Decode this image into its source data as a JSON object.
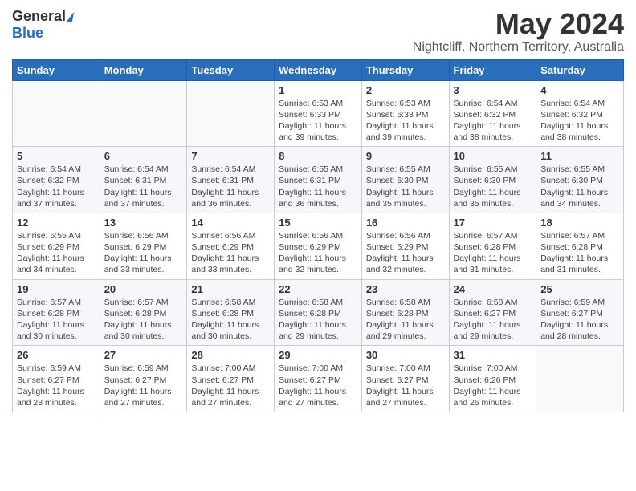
{
  "header": {
    "logo_general": "General",
    "logo_blue": "Blue",
    "month": "May 2024",
    "location": "Nightcliff, Northern Territory, Australia"
  },
  "columns": [
    "Sunday",
    "Monday",
    "Tuesday",
    "Wednesday",
    "Thursday",
    "Friday",
    "Saturday"
  ],
  "weeks": [
    [
      {
        "day": "",
        "sunrise": "",
        "sunset": "",
        "daylight": ""
      },
      {
        "day": "",
        "sunrise": "",
        "sunset": "",
        "daylight": ""
      },
      {
        "day": "",
        "sunrise": "",
        "sunset": "",
        "daylight": ""
      },
      {
        "day": "1",
        "sunrise": "Sunrise: 6:53 AM",
        "sunset": "Sunset: 6:33 PM",
        "daylight": "Daylight: 11 hours and 39 minutes."
      },
      {
        "day": "2",
        "sunrise": "Sunrise: 6:53 AM",
        "sunset": "Sunset: 6:33 PM",
        "daylight": "Daylight: 11 hours and 39 minutes."
      },
      {
        "day": "3",
        "sunrise": "Sunrise: 6:54 AM",
        "sunset": "Sunset: 6:32 PM",
        "daylight": "Daylight: 11 hours and 38 minutes."
      },
      {
        "day": "4",
        "sunrise": "Sunrise: 6:54 AM",
        "sunset": "Sunset: 6:32 PM",
        "daylight": "Daylight: 11 hours and 38 minutes."
      }
    ],
    [
      {
        "day": "5",
        "sunrise": "Sunrise: 6:54 AM",
        "sunset": "Sunset: 6:32 PM",
        "daylight": "Daylight: 11 hours and 37 minutes."
      },
      {
        "day": "6",
        "sunrise": "Sunrise: 6:54 AM",
        "sunset": "Sunset: 6:31 PM",
        "daylight": "Daylight: 11 hours and 37 minutes."
      },
      {
        "day": "7",
        "sunrise": "Sunrise: 6:54 AM",
        "sunset": "Sunset: 6:31 PM",
        "daylight": "Daylight: 11 hours and 36 minutes."
      },
      {
        "day": "8",
        "sunrise": "Sunrise: 6:55 AM",
        "sunset": "Sunset: 6:31 PM",
        "daylight": "Daylight: 11 hours and 36 minutes."
      },
      {
        "day": "9",
        "sunrise": "Sunrise: 6:55 AM",
        "sunset": "Sunset: 6:30 PM",
        "daylight": "Daylight: 11 hours and 35 minutes."
      },
      {
        "day": "10",
        "sunrise": "Sunrise: 6:55 AM",
        "sunset": "Sunset: 6:30 PM",
        "daylight": "Daylight: 11 hours and 35 minutes."
      },
      {
        "day": "11",
        "sunrise": "Sunrise: 6:55 AM",
        "sunset": "Sunset: 6:30 PM",
        "daylight": "Daylight: 11 hours and 34 minutes."
      }
    ],
    [
      {
        "day": "12",
        "sunrise": "Sunrise: 6:55 AM",
        "sunset": "Sunset: 6:29 PM",
        "daylight": "Daylight: 11 hours and 34 minutes."
      },
      {
        "day": "13",
        "sunrise": "Sunrise: 6:56 AM",
        "sunset": "Sunset: 6:29 PM",
        "daylight": "Daylight: 11 hours and 33 minutes."
      },
      {
        "day": "14",
        "sunrise": "Sunrise: 6:56 AM",
        "sunset": "Sunset: 6:29 PM",
        "daylight": "Daylight: 11 hours and 33 minutes."
      },
      {
        "day": "15",
        "sunrise": "Sunrise: 6:56 AM",
        "sunset": "Sunset: 6:29 PM",
        "daylight": "Daylight: 11 hours and 32 minutes."
      },
      {
        "day": "16",
        "sunrise": "Sunrise: 6:56 AM",
        "sunset": "Sunset: 6:29 PM",
        "daylight": "Daylight: 11 hours and 32 minutes."
      },
      {
        "day": "17",
        "sunrise": "Sunrise: 6:57 AM",
        "sunset": "Sunset: 6:28 PM",
        "daylight": "Daylight: 11 hours and 31 minutes."
      },
      {
        "day": "18",
        "sunrise": "Sunrise: 6:57 AM",
        "sunset": "Sunset: 6:28 PM",
        "daylight": "Daylight: 11 hours and 31 minutes."
      }
    ],
    [
      {
        "day": "19",
        "sunrise": "Sunrise: 6:57 AM",
        "sunset": "Sunset: 6:28 PM",
        "daylight": "Daylight: 11 hours and 30 minutes."
      },
      {
        "day": "20",
        "sunrise": "Sunrise: 6:57 AM",
        "sunset": "Sunset: 6:28 PM",
        "daylight": "Daylight: 11 hours and 30 minutes."
      },
      {
        "day": "21",
        "sunrise": "Sunrise: 6:58 AM",
        "sunset": "Sunset: 6:28 PM",
        "daylight": "Daylight: 11 hours and 30 minutes."
      },
      {
        "day": "22",
        "sunrise": "Sunrise: 6:58 AM",
        "sunset": "Sunset: 6:28 PM",
        "daylight": "Daylight: 11 hours and 29 minutes."
      },
      {
        "day": "23",
        "sunrise": "Sunrise: 6:58 AM",
        "sunset": "Sunset: 6:28 PM",
        "daylight": "Daylight: 11 hours and 29 minutes."
      },
      {
        "day": "24",
        "sunrise": "Sunrise: 6:58 AM",
        "sunset": "Sunset: 6:27 PM",
        "daylight": "Daylight: 11 hours and 29 minutes."
      },
      {
        "day": "25",
        "sunrise": "Sunrise: 6:59 AM",
        "sunset": "Sunset: 6:27 PM",
        "daylight": "Daylight: 11 hours and 28 minutes."
      }
    ],
    [
      {
        "day": "26",
        "sunrise": "Sunrise: 6:59 AM",
        "sunset": "Sunset: 6:27 PM",
        "daylight": "Daylight: 11 hours and 28 minutes."
      },
      {
        "day": "27",
        "sunrise": "Sunrise: 6:59 AM",
        "sunset": "Sunset: 6:27 PM",
        "daylight": "Daylight: 11 hours and 27 minutes."
      },
      {
        "day": "28",
        "sunrise": "Sunrise: 7:00 AM",
        "sunset": "Sunset: 6:27 PM",
        "daylight": "Daylight: 11 hours and 27 minutes."
      },
      {
        "day": "29",
        "sunrise": "Sunrise: 7:00 AM",
        "sunset": "Sunset: 6:27 PM",
        "daylight": "Daylight: 11 hours and 27 minutes."
      },
      {
        "day": "30",
        "sunrise": "Sunrise: 7:00 AM",
        "sunset": "Sunset: 6:27 PM",
        "daylight": "Daylight: 11 hours and 27 minutes."
      },
      {
        "day": "31",
        "sunrise": "Sunrise: 7:00 AM",
        "sunset": "Sunset: 6:26 PM",
        "daylight": "Daylight: 11 hours and 26 minutes."
      },
      {
        "day": "",
        "sunrise": "",
        "sunset": "",
        "daylight": ""
      }
    ]
  ]
}
